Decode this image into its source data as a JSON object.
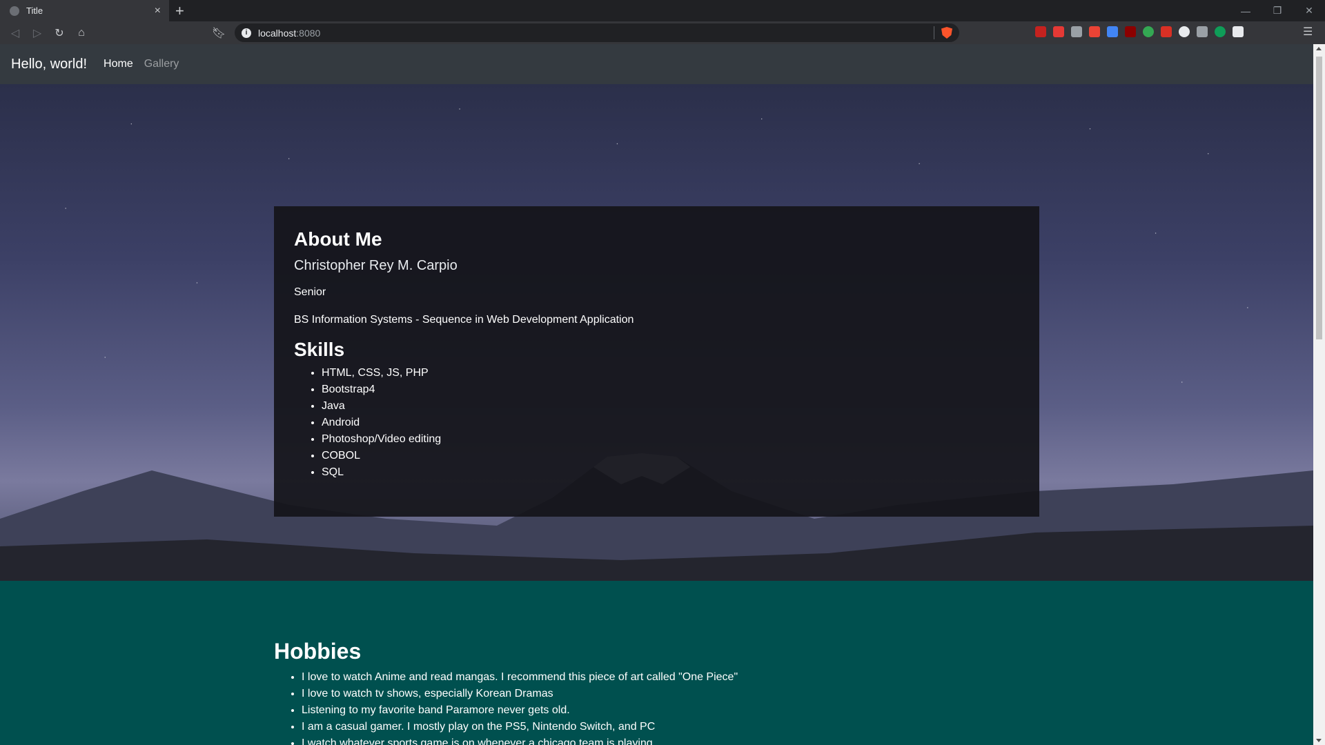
{
  "browser": {
    "tab_title": "Title",
    "tab_close": "×",
    "new_tab": "+",
    "url_host": "localhost",
    "url_port": ":8080",
    "window_controls": [
      "—",
      "❐",
      "✕"
    ]
  },
  "site": {
    "brand": "Hello, world!",
    "nav": {
      "home": "Home",
      "gallery": "Gallery"
    }
  },
  "about": {
    "title": "About Me",
    "name": "Christopher Rey M. Carpio",
    "year": "Senior",
    "degree": "BS Information Systems - Sequence in Web Development Application"
  },
  "skills": {
    "title": "Skills",
    "items": [
      "HTML, CSS, JS, PHP",
      "Bootstrap4",
      "Java",
      "Android",
      "Photoshop/Video editing",
      "COBOL",
      "SQL"
    ]
  },
  "hobbies": {
    "title": "Hobbies",
    "items": [
      "I love to watch Anime and read mangas. I recommend this piece of art called \"One Piece\"",
      "I love to watch tv shows, especially Korean Dramas",
      "Listening to my favorite band Paramore never gets old.",
      "I am a casual gamer. I mostly play on the PS5, Nintendo Switch, and PC",
      "I watch whatever sports game is on whenever a chicago team is playing"
    ]
  },
  "colors": {
    "navbar": "#343a40",
    "hobbies_bg": "#00504f",
    "card_bg": "#14141a"
  }
}
